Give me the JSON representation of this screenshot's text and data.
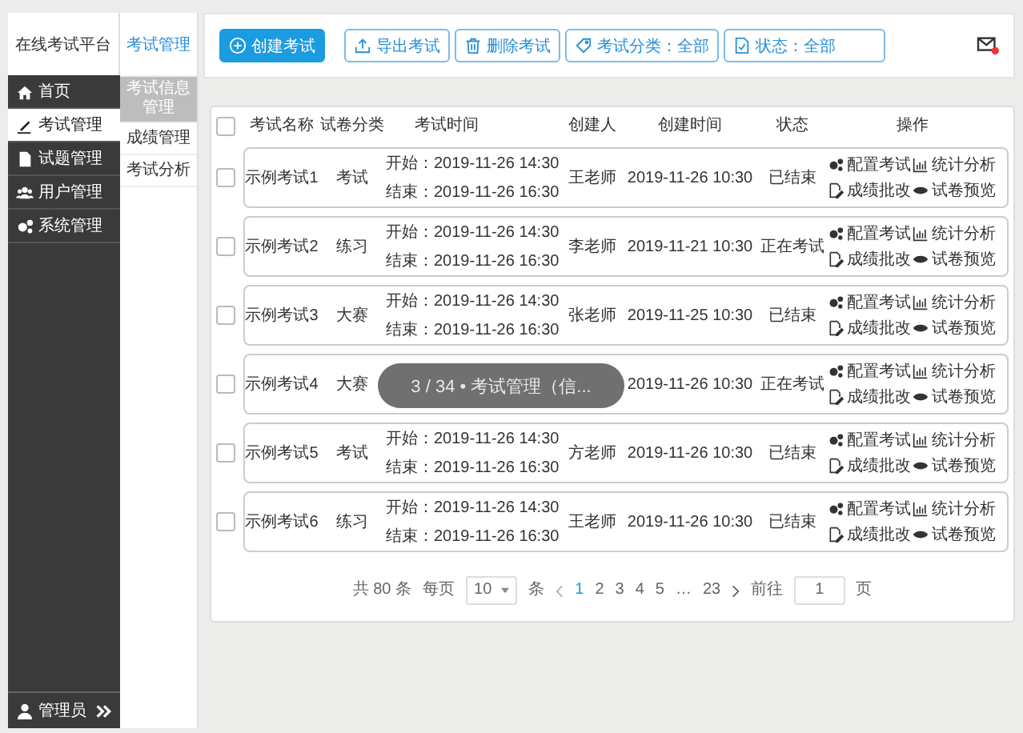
{
  "brand": "在线考试平台",
  "menu": [
    {
      "label": "首页",
      "selected": false
    },
    {
      "label": "考试管理",
      "selected": true
    },
    {
      "label": "试题管理",
      "selected": false
    },
    {
      "label": "用户管理",
      "selected": false
    },
    {
      "label": "系统管理",
      "selected": false
    }
  ],
  "user": {
    "name": "管理员"
  },
  "submenu": {
    "title": "考试管理",
    "items": [
      {
        "label": "考试信息管理",
        "selected": true
      },
      {
        "label": "成绩管理",
        "selected": false
      },
      {
        "label": "考试分析",
        "selected": false
      }
    ]
  },
  "toolbar": [
    {
      "label": "创建考试",
      "kind": "primary"
    },
    {
      "label": "导出考试",
      "kind": "plain"
    },
    {
      "label": "删除考试",
      "kind": "plain"
    },
    {
      "label": "考试分类：全部",
      "kind": "plain"
    },
    {
      "label": "状态：全部",
      "kind": "wide"
    }
  ],
  "mail": {
    "unread": true
  },
  "table": {
    "select_all": {
      "checked": false
    },
    "columns": [
      "考试名称",
      "试卷分类",
      "考试时间",
      "创建人",
      "创建时间",
      "状态",
      "操作"
    ],
    "rows": [
      {
        "checked": false,
        "name": "示例考试1",
        "category": "考试",
        "start": "开始：2019-11-26 14:30",
        "end": "结束：2019-11-26 16:30",
        "creator": "王老师",
        "created": "2019-11-26 10:30",
        "status": "已结束",
        "actions": [
          "配置考试",
          "统计分析",
          "成绩批改",
          "试卷预览"
        ]
      },
      {
        "checked": false,
        "name": "示例考试2",
        "category": "练习",
        "start": "开始：2019-11-26 14:30",
        "end": "结束：2019-11-26 16:30",
        "creator": "李老师",
        "created": "2019-11-21 10:30",
        "status": "正在考试",
        "actions": [
          "配置考试",
          "统计分析",
          "成绩批改",
          "试卷预览"
        ]
      },
      {
        "checked": false,
        "name": "示例考试3",
        "category": "大赛",
        "start": "开始：2019-11-26 14:30",
        "end": "结束：2019-11-26 16:30",
        "creator": "张老师",
        "created": "2019-11-25 10:30",
        "status": "已结束",
        "actions": [
          "配置考试",
          "统计分析",
          "成绩批改",
          "试卷预览"
        ]
      },
      {
        "checked": false,
        "name": "示例考试4",
        "category": "大赛",
        "created": "2019-11-26 10:30",
        "status": "正在考试",
        "actions": [
          "配置考试",
          "统计分析",
          "成绩批改",
          "试卷预览"
        ]
      },
      {
        "checked": false,
        "name": "示例考试5",
        "category": "考试",
        "start": "开始：2019-11-26 14:30",
        "end": "结束：2019-11-26 16:30",
        "creator": "方老师",
        "created": "2019-11-26 10:30",
        "status": "已结束",
        "actions": [
          "配置考试",
          "统计分析",
          "成绩批改",
          "试卷预览"
        ]
      },
      {
        "checked": false,
        "name": "示例考试6",
        "category": "练习",
        "start": "开始：2019-11-26 14:30",
        "end": "结束：2019-11-26 16:30",
        "creator": "王老师",
        "created": "2019-11-26 10:30",
        "status": "已结束",
        "actions": [
          "配置考试",
          "统计分析",
          "成绩批改",
          "试卷预览"
        ]
      }
    ]
  },
  "pagination": {
    "total": "共 80 条",
    "per_page_label": "每页",
    "per_page": "10",
    "per_page_unit": "条",
    "pages": [
      {
        "label": "1",
        "selected": true
      },
      {
        "label": "2",
        "selected": false
      },
      {
        "label": "3",
        "selected": false
      },
      {
        "label": "4",
        "selected": false
      },
      {
        "label": "5",
        "selected": false
      },
      {
        "label": "…",
        "selected": false
      },
      {
        "label": "23",
        "selected": false
      }
    ],
    "goto_label": "前往",
    "goto_value": "1",
    "goto_unit": "页"
  },
  "viewer_caption": "3 / 34 • 考试管理（信..."
}
